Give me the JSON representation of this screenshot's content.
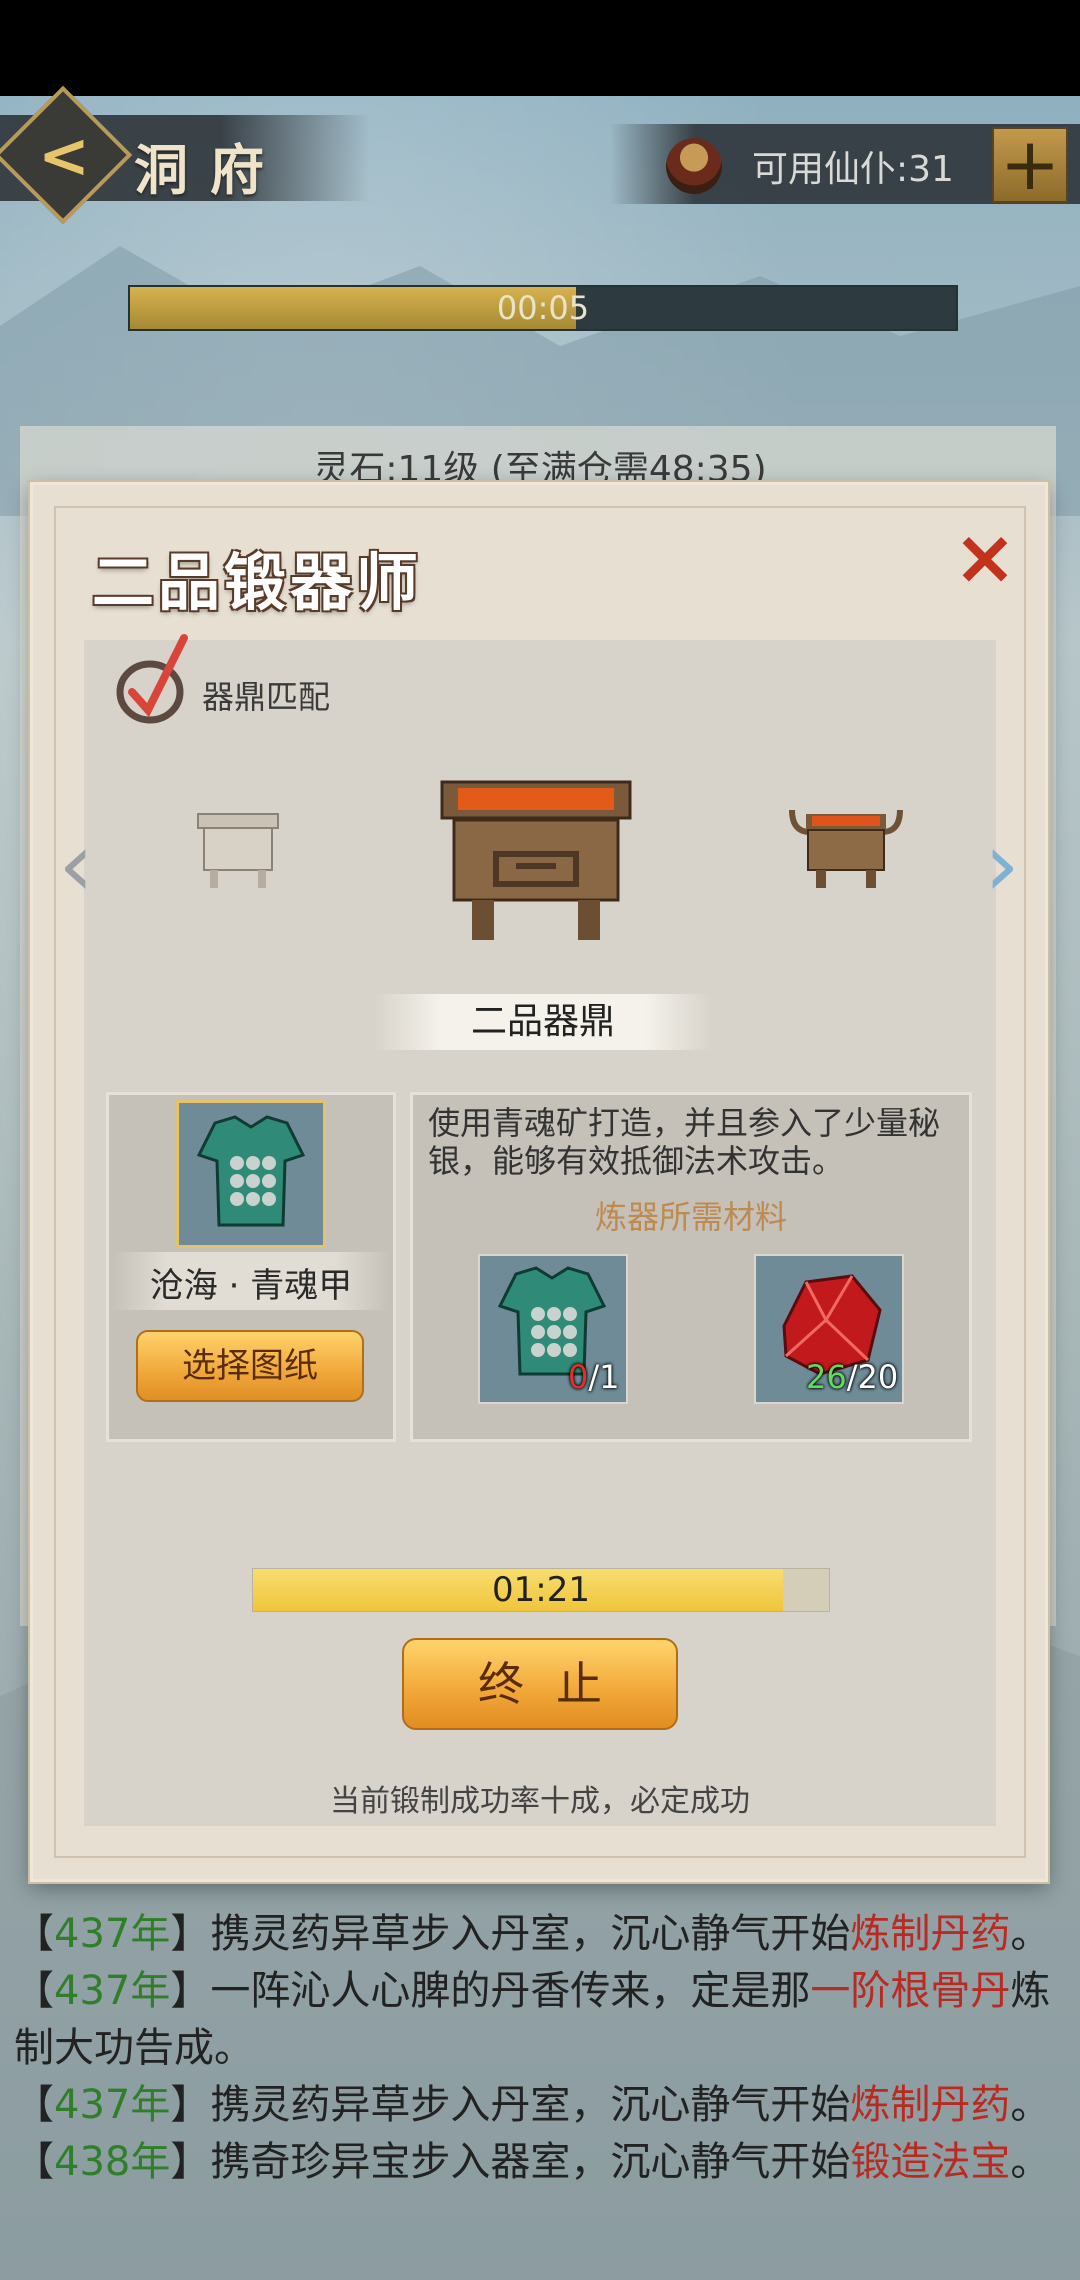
{
  "header": {
    "back_label": "<",
    "title": "洞府",
    "servants_label": "可用仙仆:31",
    "plus_label": "+"
  },
  "timer": {
    "text": "00:05",
    "progress_percent": 54
  },
  "background_card": {
    "text": "灵石:11级 (至满仓需48:35)"
  },
  "dialog": {
    "title": "二品锻器师",
    "close_label": "×",
    "match_label": "器鼎匹配",
    "cauldron_name": "二品器鼎",
    "arrow_left": "‹",
    "arrow_right": "›",
    "blueprint": {
      "name": "沧海 · 青魂甲",
      "select_button": "选择图纸",
      "icon": "armor-icon"
    },
    "description": "使用青魂矿打造，并且参入了少量秘银，能够有效抵御法术攻击。",
    "materials_title": "炼器所需材料",
    "materials": [
      {
        "icon": "armor-icon",
        "have": "0",
        "need": "/1",
        "have_color": "#e2302a"
      },
      {
        "icon": "red-ore-icon",
        "have": "26",
        "need": "/20",
        "have_color": "#5fdc5a"
      }
    ],
    "progress": {
      "text": "01:21",
      "progress_percent": 92
    },
    "stop_button": "终止",
    "success_text": "当前锻制成功率十成，必定成功"
  },
  "log": [
    {
      "open": "【",
      "year": "437年",
      "close": "】",
      "text": "携灵药异草步入丹室，沉心静气开始",
      "highlight": "炼制丹药",
      "end": "。"
    },
    {
      "open": "【",
      "year": "437年",
      "close": "】",
      "text": "一阵沁人心脾的丹香传来，定是那",
      "highlight": "一阶根骨丹",
      "end": "炼制大功告成。"
    },
    {
      "open": "【",
      "year": "437年",
      "close": "】",
      "text": "携灵药异草步入丹室，沉心静气开始",
      "highlight": "炼制丹药",
      "end": "。"
    },
    {
      "open": "【",
      "year": "438年",
      "close": "】",
      "text": "携奇珍异宝步入器室，沉心静气开始",
      "highlight": "锻造法宝",
      "end": "。"
    }
  ]
}
